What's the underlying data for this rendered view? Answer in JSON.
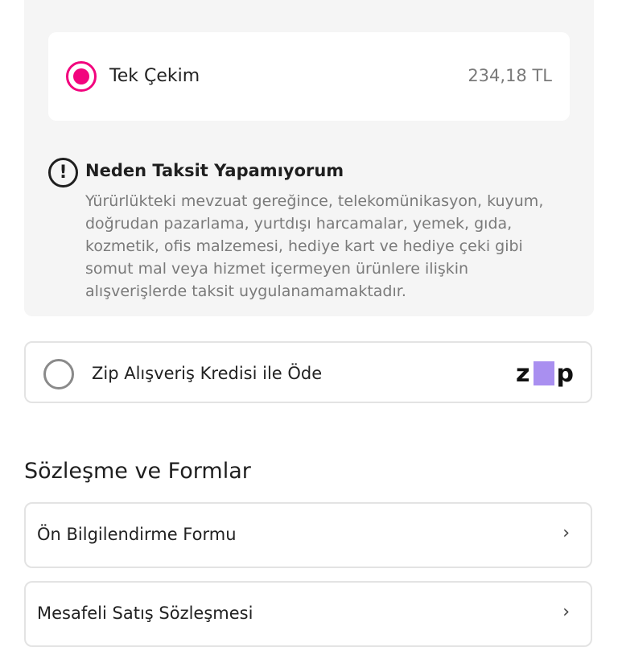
{
  "installments": {
    "option": {
      "label": "Tek Çekim",
      "price": "234,18 TL",
      "selected": true
    },
    "warning": {
      "icon": "exclamation-circle-icon",
      "title": "Neden Taksit Yapamıyorum",
      "text": "Yürürlükteki mevzuat gereğince, telekomünikasyon, kuyum, doğrudan pazarlama, yurtdışı harcamalar, yemek, gıda, kozmetik, ofis malzemesi, hediye kart ve hediye çeki gibi somut mal veya hizmet içermeyen ürünlere ilişkin alışverişlerde taksit uygulanamamaktadır."
    }
  },
  "zip": {
    "label": "Zip Alışveriş Kredisi ile Öde",
    "logo_text_left": "z",
    "logo_text_right": "p",
    "selected": false
  },
  "contracts": {
    "title": "Sözleşme ve Formlar",
    "items": [
      {
        "label": "Ön Bilgilendirme Formu",
        "icon": "chevron-right-icon"
      },
      {
        "label": "Mesafeli Satış Sözleşmesi",
        "icon": "chevron-right-icon"
      }
    ]
  },
  "colors": {
    "accent": "#f2047e",
    "zip_purple": "#a98ff0",
    "panel_bg": "#f5f5f5"
  }
}
